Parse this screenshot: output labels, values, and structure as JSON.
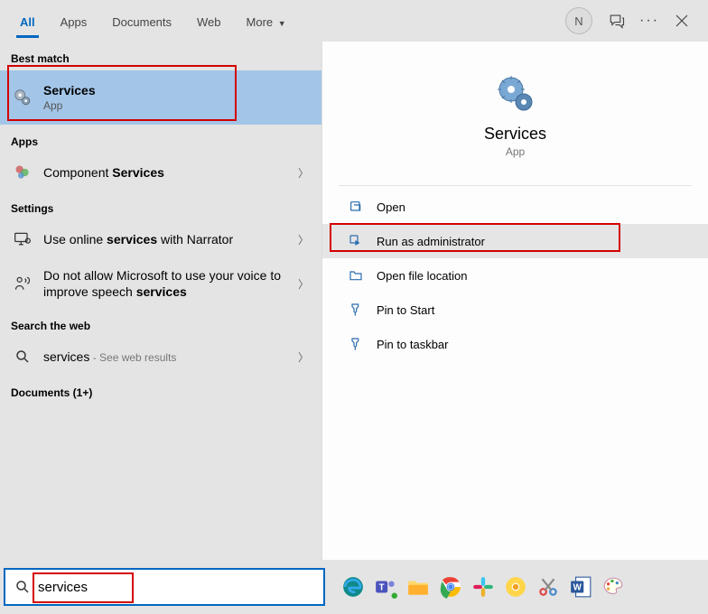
{
  "tabs": {
    "all": "All",
    "apps": "Apps",
    "documents": "Documents",
    "web": "Web",
    "more": "More"
  },
  "user_initial": "N",
  "sections": {
    "best_match": "Best match",
    "apps": "Apps",
    "settings": "Settings",
    "search_web": "Search the web",
    "documents": "Documents (1+)"
  },
  "results": {
    "services": {
      "title": "Services",
      "sub": "App"
    },
    "component": "Component Services",
    "narrator": "Use online services with Narrator",
    "speech": "Do not allow Microsoft to use your voice to improve speech services",
    "web": {
      "term": "services",
      "suffix": " - See web results"
    }
  },
  "preview": {
    "title": "Services",
    "sub": "App",
    "actions": {
      "open": "Open",
      "admin": "Run as administrator",
      "location": "Open file location",
      "pin_start": "Pin to Start",
      "pin_taskbar": "Pin to taskbar"
    }
  },
  "search": {
    "value": "services"
  }
}
